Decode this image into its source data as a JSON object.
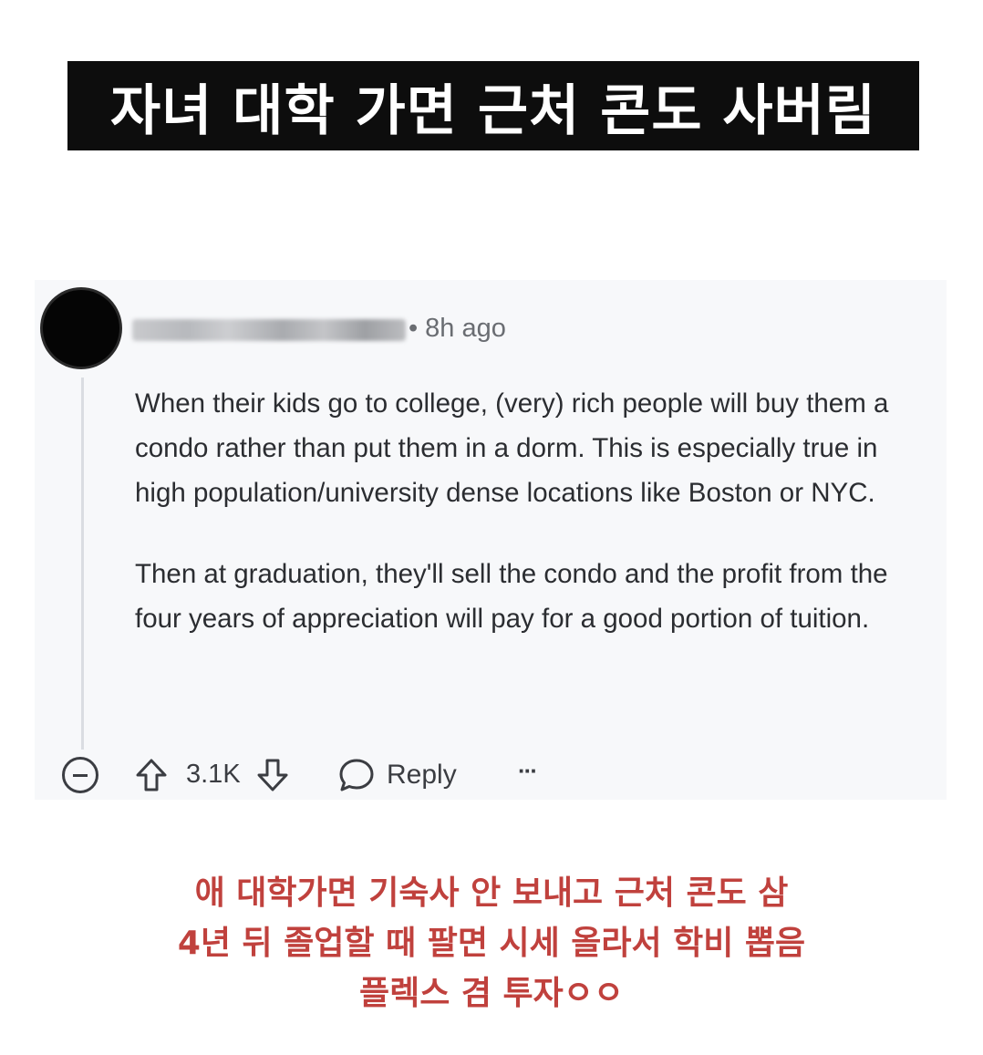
{
  "title_banner": {
    "text": "자녀 대학 가면 근처 콘도 사버림"
  },
  "comment": {
    "time_ago": "8h ago",
    "paragraphs": [
      "When their kids go to college, (very) rich people will buy them a condo rather than put them in a dorm. This is especially true in high population/university dense locations like Boston or NYC.",
      "Then at graduation, they'll sell the condo and the profit from the four years of appreciation will pay for a good portion of tuition."
    ],
    "actions": {
      "score": "3.1K",
      "reply_label": "Reply",
      "more_label": "···"
    }
  },
  "caption": {
    "lines": [
      "애 대학가면 기숙사 안 보내고 근처 콘도 삼",
      "4년 뒤 졸업할 때 팔면 시세 올라서 학비 뽑음",
      "플렉스 겸 투자ㅇㅇ"
    ]
  },
  "colors": {
    "banner_bg": "#0d0d0d",
    "banner_text": "#ffffff",
    "card_bg": "#f7f8fa",
    "caption_red": "#c0413d"
  },
  "icons": [
    "collapse-icon",
    "upvote-icon",
    "downvote-icon",
    "reply-icon",
    "more-icon"
  ]
}
